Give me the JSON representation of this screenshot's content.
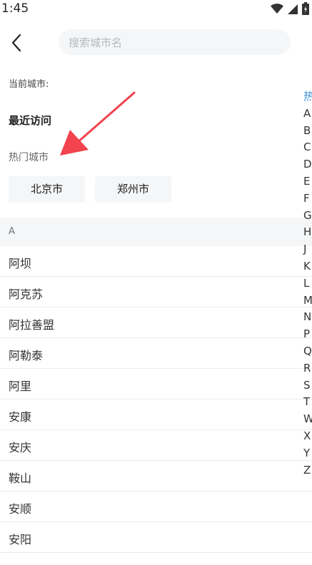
{
  "status_bar": {
    "time": "1:45"
  },
  "search": {
    "placeholder": "搜索城市名"
  },
  "current_city": {
    "label": "当前城市:"
  },
  "recent": {
    "heading": "最近访问"
  },
  "hot": {
    "heading": "热门城市",
    "cities": [
      "北京市",
      "郑州市"
    ]
  },
  "section": {
    "letter": "A"
  },
  "cities": [
    "阿坝",
    "阿克苏",
    "阿拉善盟",
    "阿勒泰",
    "阿里",
    "安康",
    "安庆",
    "鞍山",
    "安顺",
    "安阳"
  ],
  "index_bar": [
    "热",
    "A",
    "B",
    "C",
    "D",
    "E",
    "F",
    "G",
    "H",
    "J",
    "K",
    "L",
    "M",
    "N",
    "P",
    "Q",
    "R",
    "S",
    "T",
    "W",
    "X",
    "Y",
    "Z"
  ],
  "colors": {
    "annotation_arrow": "#f2434e",
    "index_hot": "#3a8fd6",
    "section_background": "#f5f6f8"
  },
  "icons": {
    "back": "chevron-left-icon",
    "wifi": "wifi-icon",
    "signal": "signal-icon",
    "battery": "battery-icon"
  }
}
